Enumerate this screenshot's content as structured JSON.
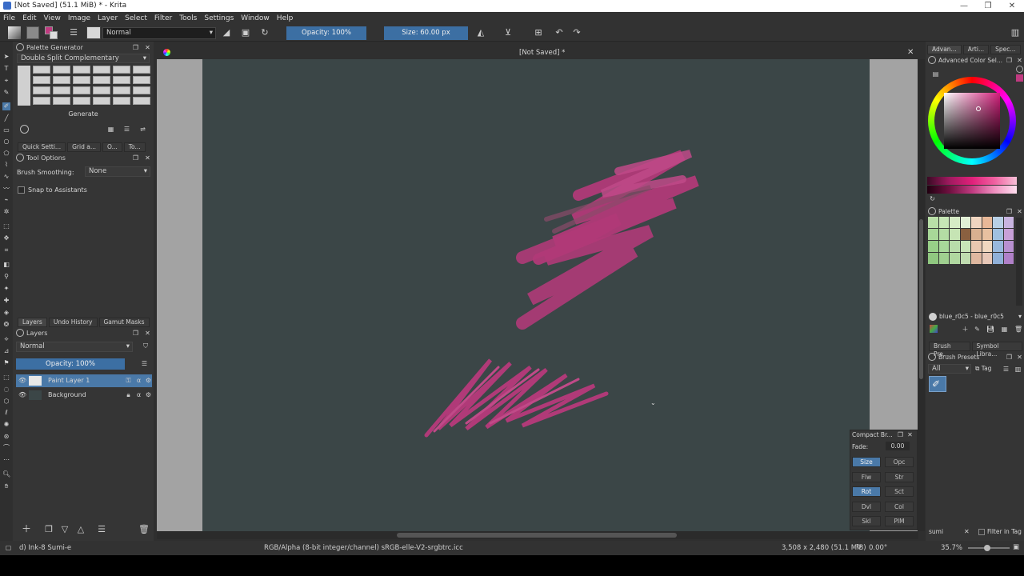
{
  "window": {
    "title": "[Not Saved] (51.1 MiB) * - Krita",
    "minimize": "—",
    "maximize": "❐",
    "close": "✕"
  },
  "menu": [
    "File",
    "Edit",
    "View",
    "Image",
    "Layer",
    "Select",
    "Filter",
    "Tools",
    "Settings",
    "Window",
    "Help"
  ],
  "toolbar": {
    "blend_mode": "Normal",
    "opacity": "Opacity: 100%",
    "size": "Size: 60.00 px"
  },
  "palette_generator": {
    "title": "Palette Generator",
    "scheme": "Double Split Complementary",
    "generate_label": "Generate"
  },
  "left_tabs": [
    "Quick Setti...",
    "Grid a...",
    "O...",
    "To..."
  ],
  "tool_options": {
    "title": "Tool Options",
    "brush_smoothing_label": "Brush Smoothing:",
    "brush_smoothing_value": "None",
    "snap_label": "Snap to Assistants"
  },
  "layers_tabs": [
    "Layers",
    "Undo History",
    "Gamut Masks"
  ],
  "layers": {
    "title": "Layers",
    "blend_mode": "Normal",
    "opacity": "Opacity: 100%",
    "items": [
      {
        "name": "Paint Layer 1"
      },
      {
        "name": "Background"
      }
    ]
  },
  "document": {
    "tab_title": "[Not Saved] *"
  },
  "right_tabs": [
    "Advan...",
    "Arti...",
    "Spec..."
  ],
  "advanced_color": {
    "title": "Advanced Color Sel..."
  },
  "palette": {
    "title": "Palette",
    "name": "blue_r0c5 - blue_r0c5",
    "swatch_colors": [
      [
        "#b9e0a8",
        "#c6e6b6",
        "#d6ecc6",
        "#e2f0d6",
        "#f0d5c0",
        "#e8b898",
        "#b8d0e6",
        "#c8b4e0"
      ],
      [
        "#a8d898",
        "#b4dca4",
        "#c6e4b4",
        "#8a6040",
        "#d8b090",
        "#e8c0a0",
        "#a0c0e0",
        "#c8a0d8"
      ],
      [
        "#98d088",
        "#a8d89a",
        "#b8dcaa",
        "#c8e4b8",
        "#e8c8b0",
        "#f0d8c0",
        "#98b8dc",
        "#b890d0"
      ],
      [
        "#90c880",
        "#a0d090",
        "#b0d8a0",
        "#c0dcb0",
        "#e0b8a0",
        "#e8c8b8",
        "#90b0d8",
        "#b080c8"
      ]
    ]
  },
  "right_bottom_tabs": [
    "Brush Pre...",
    "Symbol Libra..."
  ],
  "brush_presets": {
    "title": "Brush Presets",
    "filter": "All",
    "tag_label": "Tag",
    "search_value": "sumi",
    "filter_in_tag": "Filter in Tag"
  },
  "compact_brush": {
    "title": "Compact Br...",
    "fade_label": "Fade:",
    "fade_value": "0.00",
    "buttons": [
      {
        "label": "Size",
        "on": true
      },
      {
        "label": "Opc",
        "on": false
      },
      {
        "label": "Flw",
        "on": false
      },
      {
        "label": "Str",
        "on": false
      },
      {
        "label": "Rot",
        "on": true
      },
      {
        "label": "Sct",
        "on": false
      },
      {
        "label": "Dvl",
        "on": false
      },
      {
        "label": "Col",
        "on": false
      },
      {
        "label": "Skl",
        "on": false
      },
      {
        "label": "PIM",
        "on": false
      }
    ]
  },
  "status": {
    "brush": "d) Ink-8 Sumi-e",
    "color_profile": "RGB/Alpha (8-bit integer/channel)  sRGB-elle-V2-srgbtrc.icc",
    "dimensions": "3,508 x 2,480 (51.1 MiB)",
    "rotation": "0.00°",
    "zoom": "35.7%"
  },
  "colors": {
    "stroke": "#b03a78",
    "canvas": "#3b4647",
    "accent": "#4a79a8"
  }
}
